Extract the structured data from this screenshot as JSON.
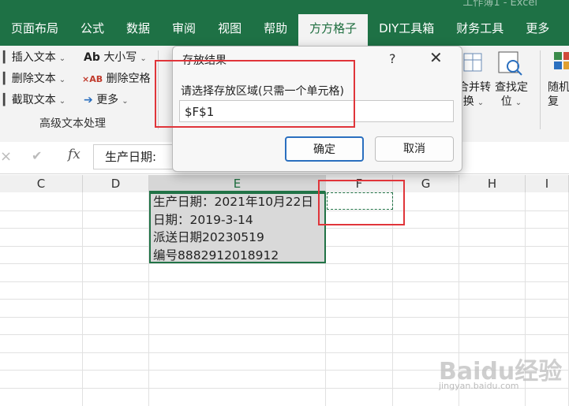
{
  "ribbon_tabs": [
    "页面布局",
    "公式",
    "数据",
    "审阅",
    "视图",
    "帮助",
    "方方格子",
    "DIY工具箱",
    "财务工具",
    "更多"
  ],
  "active_tab_index": 6,
  "title_hint": "工作簿1 - Excel",
  "ribbon": {
    "left_buttons": [
      {
        "icon": "insert-text-icon",
        "label": "插入文本"
      },
      {
        "icon": "delete-text-icon",
        "label": "删除文本"
      },
      {
        "icon": "cut-text-icon",
        "label": "截取文本"
      }
    ],
    "mid_buttons": [
      {
        "prefix": "Ab",
        "label": "大小写"
      },
      {
        "prefix": "×AB",
        "label": "删除空格"
      },
      {
        "prefix": "➔",
        "label": "更多"
      }
    ],
    "group_label": "高级文本处理",
    "right_buttons": [
      {
        "line1": "合并转",
        "line2": "换"
      },
      {
        "line1": "查找定",
        "line2": "位"
      },
      {
        "line1": "随机",
        "line2": "复"
      }
    ]
  },
  "formula_bar": {
    "content": "生产日期:",
    "cancel_icon": "×",
    "confirm_icon": "✔",
    "fx": "fx"
  },
  "columns": [
    "C",
    "D",
    "E",
    "F",
    "G",
    "H",
    "I"
  ],
  "selected_column": "E",
  "cells": [
    "生产日期：2021年10月22日",
    "日期：2019-3-14",
    "派送日期20230519",
    "编号8882912018912"
  ],
  "dialog": {
    "title": "存放结果",
    "help": "?",
    "close": "✕",
    "prompt": "请选择存放区域(只需一个单元格)",
    "input_value": "$F$1",
    "ok": "确定",
    "cancel": "取消"
  },
  "watermark": {
    "line1": "Baidu经验",
    "line2": "jingyan.baidu.com"
  },
  "colors": {
    "excel_green": "#1e7145",
    "annotation_red": "#e0353a",
    "selection_border": "#217346"
  }
}
